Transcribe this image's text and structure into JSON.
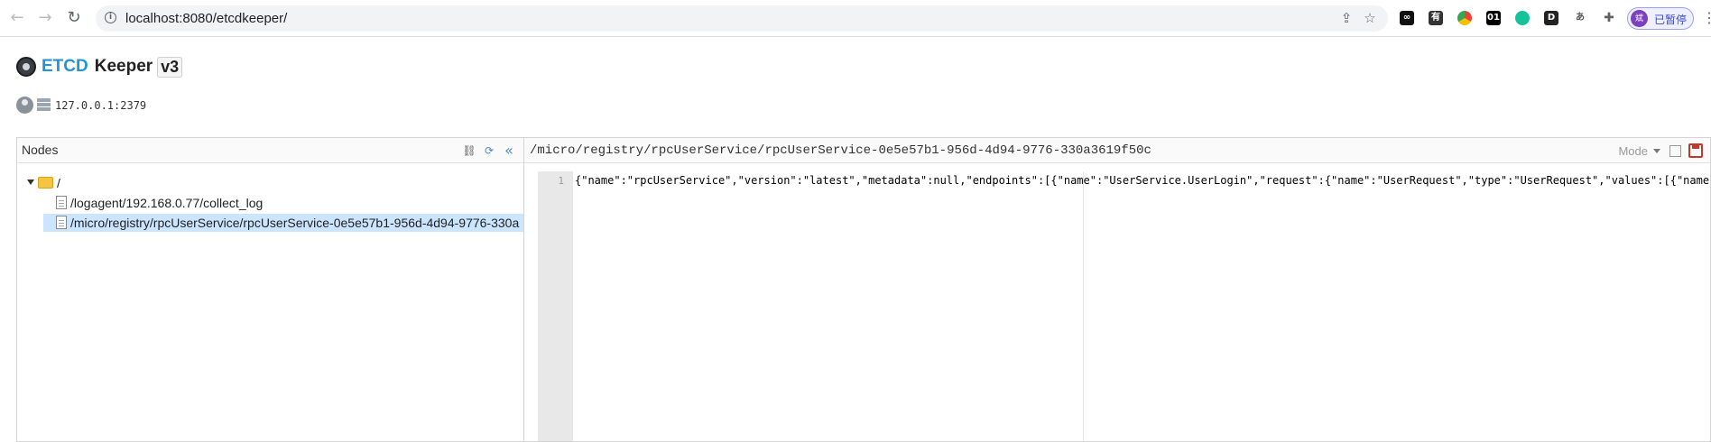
{
  "browser": {
    "url": "localhost:8080/etcdkeeper/",
    "profile_label": "已暂停",
    "profile_avatar_text": "斌",
    "extensions": [
      "infinity-icon",
      "youdao-icon",
      "chrome-color-icon",
      "01-icon",
      "grammarly-icon",
      "d-icon",
      "translate-icon",
      "puzzle-icon"
    ],
    "extension_labels": [
      "∞",
      "有",
      "",
      "01",
      "",
      "D",
      "あ",
      ""
    ]
  },
  "app": {
    "title_part1": "ETCD",
    "title_part2": "Keeper",
    "title_version": "v3",
    "server_address": "127.0.0.1:2379"
  },
  "nodes_panel": {
    "title": "Nodes",
    "tree": [
      {
        "label": "/",
        "type": "folder",
        "expanded": true
      },
      {
        "label": "/logagent/192.168.0.77/collect_log",
        "type": "file",
        "selected": false
      },
      {
        "label": "/micro/registry/rpcUserService/rpcUserService-0e5e57b1-956d-4d94-9776-330a",
        "type": "file",
        "selected": true
      }
    ]
  },
  "editor_panel": {
    "key_path": "/micro/registry/rpcUserService/rpcUserService-0e5e57b1-956d-4d94-9776-330a3619f50c",
    "mode_label": "Mode",
    "line_number": "1",
    "code": "{\"name\":\"rpcUserService\",\"version\":\"latest\",\"metadata\":null,\"endpoints\":[{\"name\":\"UserService.UserLogin\",\"request\":{\"name\":\"UserRequest\",\"type\":\"UserRequest\",\"values\":[{\"name\":\"F"
  },
  "colors": {
    "brand_blue": "#2196d3",
    "selection": "#cce5ff",
    "folder": "#f5c542",
    "save_red": "#c0392b"
  }
}
